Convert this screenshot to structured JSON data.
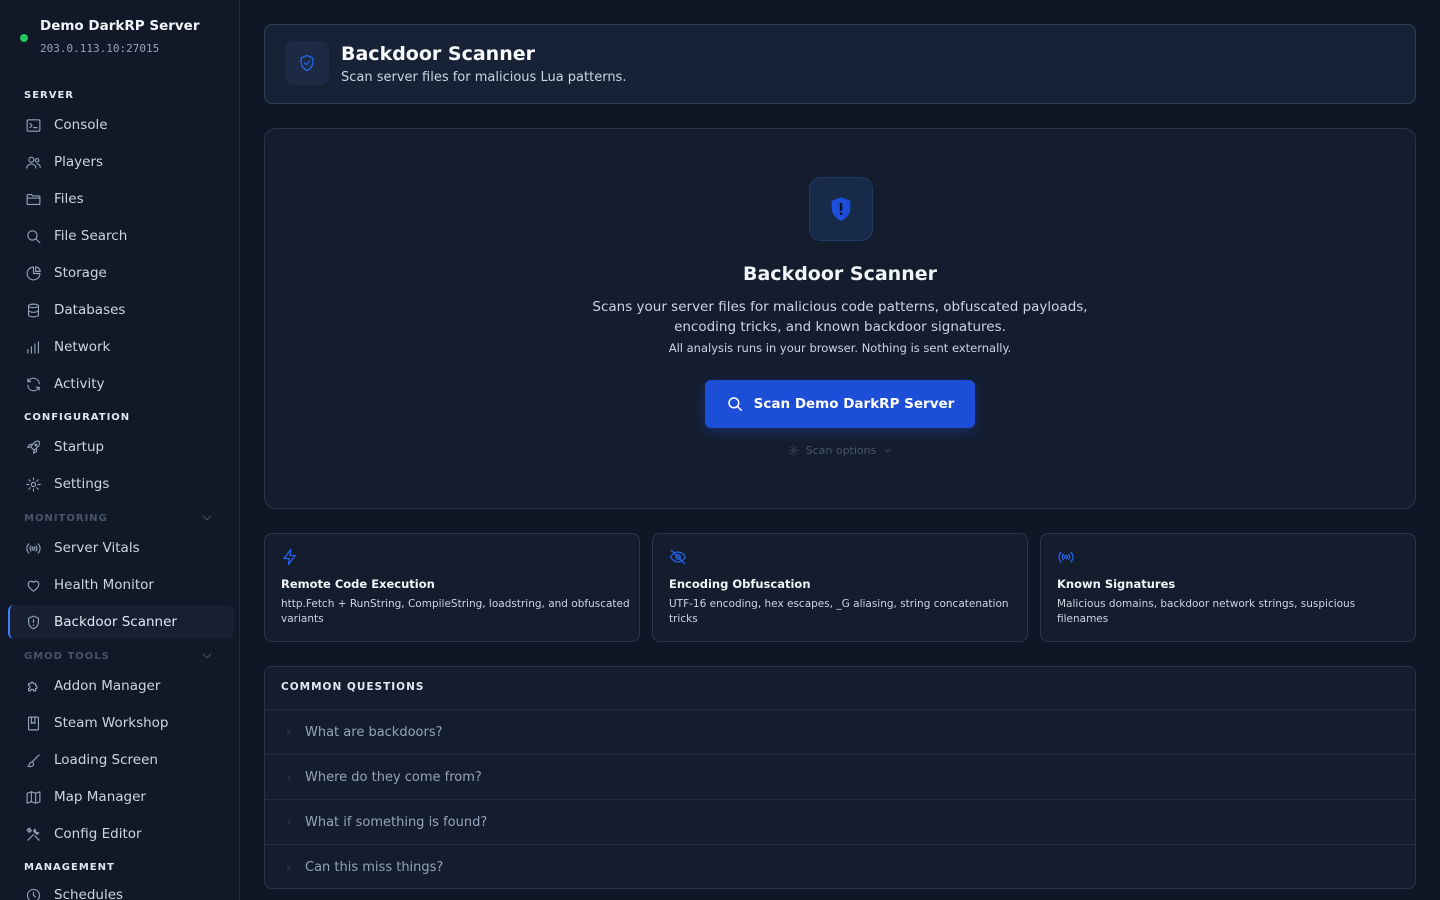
{
  "server": {
    "name": "Demo DarkRP Server",
    "address": "203.0.113.10:27015"
  },
  "sidebar": {
    "sections": {
      "server": "SERVER",
      "configuration": "CONFIGURATION",
      "monitoring": "MONITORING",
      "gmod_tools": "GMOD TOOLS",
      "management": "MANAGEMENT"
    },
    "items": [
      {
        "label": "Console",
        "icon": "terminal-icon"
      },
      {
        "label": "Players",
        "icon": "users-icon"
      },
      {
        "label": "Files",
        "icon": "folder-icon"
      },
      {
        "label": "File Search",
        "icon": "search-icon"
      },
      {
        "label": "Storage",
        "icon": "pie-chart-icon"
      },
      {
        "label": "Databases",
        "icon": "database-icon"
      },
      {
        "label": "Network",
        "icon": "bar-chart-icon"
      },
      {
        "label": "Activity",
        "icon": "refresh-icon"
      },
      {
        "label": "Startup",
        "icon": "rocket-icon"
      },
      {
        "label": "Settings",
        "icon": "gear-icon"
      },
      {
        "label": "Server Vitals",
        "icon": "broadcast-icon"
      },
      {
        "label": "Health Monitor",
        "icon": "heart-icon"
      },
      {
        "label": "Backdoor Scanner",
        "icon": "shield-alert-icon",
        "active": true
      },
      {
        "label": "Addon Manager",
        "icon": "puzzle-icon"
      },
      {
        "label": "Steam Workshop",
        "icon": "book-icon"
      },
      {
        "label": "Loading Screen",
        "icon": "brush-icon"
      },
      {
        "label": "Map Manager",
        "icon": "map-icon"
      },
      {
        "label": "Config Editor",
        "icon": "tools-icon"
      },
      {
        "label": "Schedules",
        "icon": "clock-icon"
      }
    ]
  },
  "header": {
    "title": "Backdoor Scanner",
    "subtitle": "Scan server files for malicious Lua patterns."
  },
  "hero": {
    "title": "Backdoor Scanner",
    "description": "Scans your server files for malicious code patterns, obfuscated payloads, encoding tricks, and known backdoor signatures.",
    "note": "All analysis runs in your browser. Nothing is sent externally.",
    "scan_button": "Scan Demo DarkRP Server",
    "scan_options": "Scan options"
  },
  "features": [
    {
      "title": "Remote Code Execution",
      "description": "http.Fetch + RunString, CompileString, loadstring, and obfuscated variants",
      "icon": "bolt-icon"
    },
    {
      "title": "Encoding Obfuscation",
      "description": "UTF-16 encoding, hex escapes, _G aliasing, string concatenation tricks",
      "icon": "eye-off-icon"
    },
    {
      "title": "Known Signatures",
      "description": "Malicious domains, backdoor network strings, suspicious filenames",
      "icon": "broadcast-icon"
    }
  ],
  "faq": {
    "heading": "COMMON QUESTIONS",
    "items": [
      "What are backdoors?",
      "Where do they come from?",
      "What if something is found?",
      "Can this miss things?"
    ]
  },
  "colors": {
    "accent": "#1d4ed8",
    "status_online": "#22c55e",
    "background": "#0f1626"
  }
}
